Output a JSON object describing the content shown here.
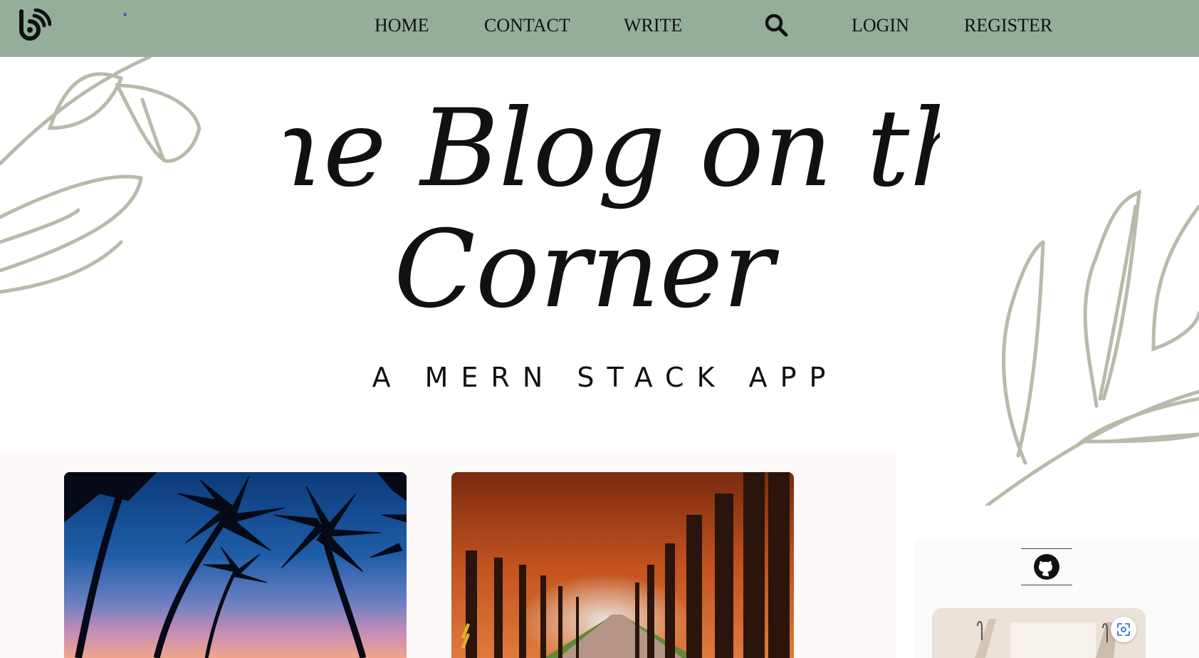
{
  "nav": {
    "logo_icon": "blog-feed-logo-icon",
    "items": [
      {
        "label": "HOME"
      },
      {
        "label": "CONTACT"
      },
      {
        "label": "WRITE"
      }
    ],
    "search_icon": "search-icon",
    "auth": [
      {
        "label": "LOGIN"
      },
      {
        "label": "REGISTER"
      }
    ]
  },
  "header": {
    "title_line1": "The Blog on the",
    "title_line2": "Corner",
    "subtitle": "A MERN STACK APP"
  },
  "posts": [
    {
      "image": "palm-trees-sunset-image"
    },
    {
      "image": "autumn-tree-path-image"
    }
  ],
  "sidebar": {
    "github_icon": "github-icon",
    "about_image": "about-me-image",
    "lens_icon": "visual-search-icon"
  },
  "colors": {
    "topbar": "#95ae9a",
    "leaf": "#b5bcaa",
    "text": "#111111",
    "posts_bg": "#fdf9f9"
  }
}
